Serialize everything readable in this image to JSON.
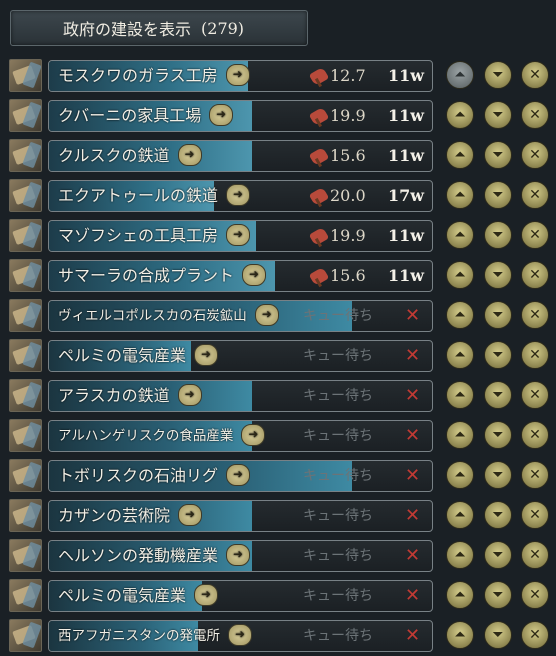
{
  "header": {
    "title": "政府の建設を表示",
    "count": "(279)"
  },
  "icons": {
    "up": "move-up-icon",
    "down": "move-down-icon",
    "cancel": "cancel-icon",
    "go": "go-to-arrow-icon",
    "resource": "construction-resource-icon"
  },
  "colors": {
    "progress": "#3d89a3",
    "cancel_mark": "#c23a34",
    "button_gold": "#c9c07f"
  },
  "rows": [
    {
      "name": "モスクワのガラス工房",
      "progress": 0.52,
      "resource": "12.7",
      "weeks": "11w",
      "queued": "",
      "up_disabled": true,
      "small": false
    },
    {
      "name": "クバーニの家具工場",
      "progress": 0.53,
      "resource": "19.9",
      "weeks": "11w",
      "queued": "",
      "up_disabled": false,
      "small": false
    },
    {
      "name": "クルスクの鉄道",
      "progress": 0.53,
      "resource": "15.6",
      "weeks": "11w",
      "queued": "",
      "up_disabled": false,
      "small": false
    },
    {
      "name": "エクアトゥールの鉄道",
      "progress": 0.43,
      "resource": "20.0",
      "weeks": "17w",
      "queued": "",
      "up_disabled": false,
      "small": false
    },
    {
      "name": "マゾフシェの工具工房",
      "progress": 0.54,
      "resource": "19.9",
      "weeks": "11w",
      "queued": "",
      "up_disabled": false,
      "small": false
    },
    {
      "name": "サマーラの合成プラント",
      "progress": 0.59,
      "resource": "15.6",
      "weeks": "11w",
      "queued": "",
      "up_disabled": false,
      "small": false
    },
    {
      "name": "ヴィエルコポルスカの石炭鉱山",
      "progress": 0.79,
      "resource": "",
      "weeks": "",
      "queued": "キュー待ち",
      "up_disabled": false,
      "small": true
    },
    {
      "name": "ペルミの電気産業",
      "progress": 0.37,
      "resource": "",
      "weeks": "",
      "queued": "キュー待ち",
      "up_disabled": false,
      "small": false
    },
    {
      "name": "アラスカの鉄道",
      "progress": 0.53,
      "resource": "",
      "weeks": "",
      "queued": "キュー待ち",
      "up_disabled": false,
      "small": false
    },
    {
      "name": "アルハンゲリスクの食品産業",
      "progress": 0.53,
      "resource": "",
      "weeks": "",
      "queued": "キュー待ち",
      "up_disabled": false,
      "small": true
    },
    {
      "name": "トボリスクの石油リグ",
      "progress": 0.79,
      "resource": "",
      "weeks": "",
      "queued": "キュー待ち",
      "up_disabled": false,
      "small": false
    },
    {
      "name": "カザンの芸術院",
      "progress": 0.53,
      "resource": "",
      "weeks": "",
      "queued": "キュー待ち",
      "up_disabled": false,
      "small": false
    },
    {
      "name": "ヘルソンの発動機産業",
      "progress": 0.53,
      "resource": "",
      "weeks": "",
      "queued": "キュー待ち",
      "up_disabled": false,
      "small": false
    },
    {
      "name": "ペルミの電気産業",
      "progress": 0.4,
      "resource": "",
      "weeks": "",
      "queued": "キュー待ち",
      "up_disabled": false,
      "small": false
    },
    {
      "name": "西アフガニスタンの発電所",
      "progress": 0.39,
      "resource": "",
      "weeks": "",
      "queued": "キュー待ち",
      "up_disabled": false,
      "small": true
    }
  ]
}
